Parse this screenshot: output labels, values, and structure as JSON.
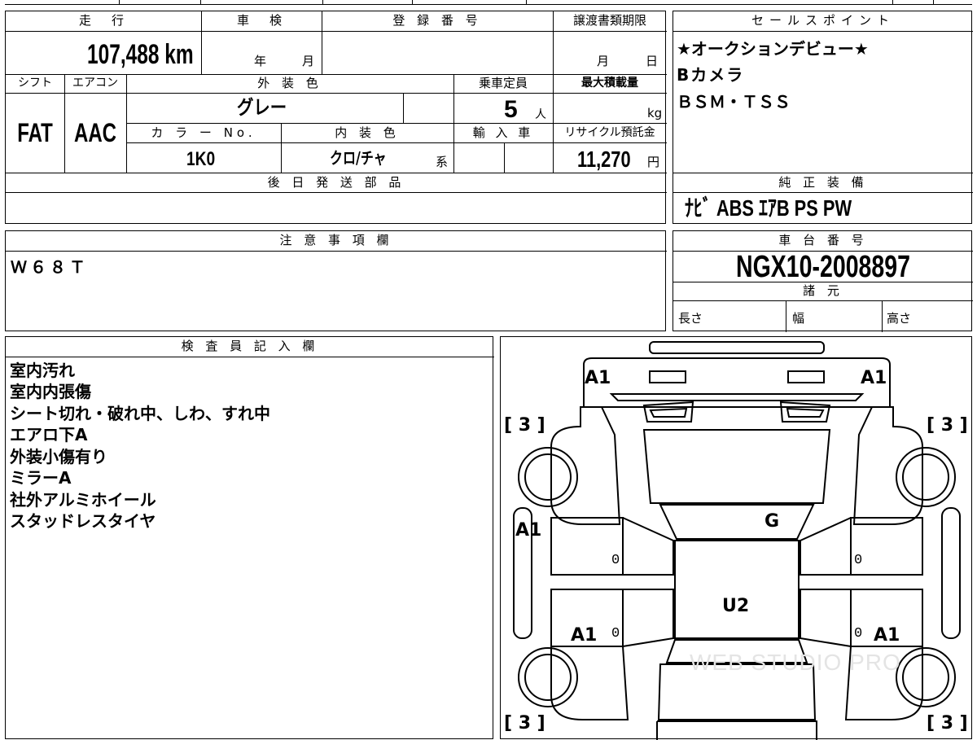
{
  "top_strip": {
    "partial_text": "■■■■"
  },
  "vehicle": {
    "mileage_label": "走　行",
    "mileage_value": "107,488 km",
    "inspection_label": "車　検",
    "inspection_year_unit": "年",
    "inspection_month_unit": "月",
    "registration_label": "登 録 番 号",
    "registration_value": "",
    "transfer_deadline_label": "譲渡書類期限",
    "transfer_month_unit": "月",
    "transfer_day_unit": "日",
    "shift_label": "シフト",
    "shift_value": "FAT",
    "ac_label": "エアコン",
    "ac_value": "AAC",
    "exterior_color_label": "外 装 色",
    "exterior_color_value": "グレー",
    "capacity_label": "乗車定員",
    "capacity_value": "5",
    "capacity_unit": "人",
    "max_load_label": "最大積載量",
    "max_load_unit": "kg",
    "color_no_label": "カ ラ ー No.",
    "color_no_value": "1K0",
    "interior_color_label": "内 装 色",
    "interior_color_value": "クロ/チャ",
    "interior_color_suffix": "系",
    "import_label": "輸 入 車",
    "recycle_label": "リサイクル預託金",
    "recycle_value": "11,270",
    "recycle_unit": "円",
    "later_parts_label": "後 日 発 送 部 品",
    "later_parts_value": ""
  },
  "sales_point": {
    "label": "セールスポイント",
    "lines": [
      "★オークションデビュー★",
      "Bカメラ",
      "ＢＳＭ・ＴＳＳ"
    ]
  },
  "equipment": {
    "label": "純 正 装 備",
    "value": "ﾅﾋﾞ ABS ｴｱB PS PW"
  },
  "notes": {
    "label": "注 意 事 項 欄",
    "value": "Ｗ６８Ｔ"
  },
  "chassis": {
    "label": "車 台 番 号",
    "value": "NGX10-2008897",
    "specs_label": "諸 元",
    "length_label": "長さ",
    "width_label": "幅",
    "height_label": "高さ"
  },
  "inspector": {
    "label": "検 査 員 記 入 欄",
    "lines": [
      "室内汚れ",
      "室内内張傷",
      "シート切れ・破れ中、しわ、すれ中",
      "エアロ下A",
      "外装小傷有り",
      "ミラーA",
      "社外アルミホイール",
      "スタッドレスタイヤ"
    ]
  },
  "diagram": {
    "marks": {
      "front_left": "A1",
      "front_right": "A1",
      "left_side": "A1",
      "rear_left": "A1",
      "rear_right": "A1",
      "hood": "G",
      "roof": "U2"
    },
    "tires": {
      "front_left": "[ 3 ]",
      "front_right": "[ 3 ]",
      "rear_left": "[ 3 ]",
      "rear_right": "[ 3 ]"
    },
    "zeros": [
      "0",
      "0",
      "0",
      "0"
    ],
    "watermark": "WEB STUDIO PRO"
  }
}
